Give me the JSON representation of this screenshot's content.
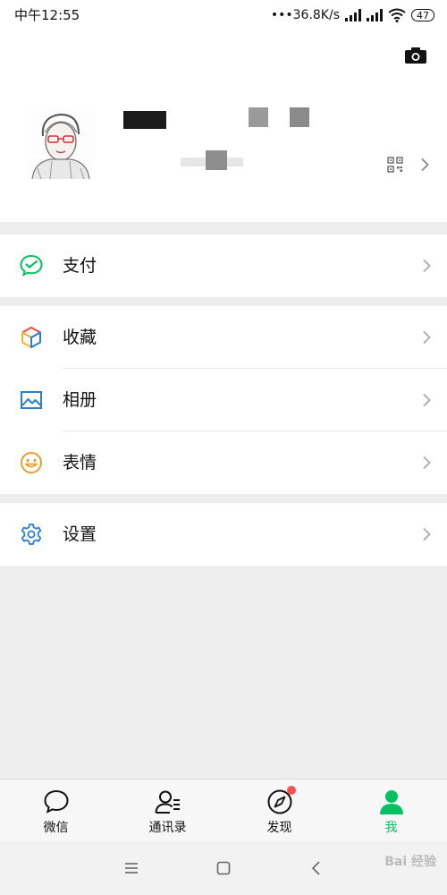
{
  "status_bar": {
    "time": "中午12:55",
    "speed": "•••36.8K/s",
    "battery": "47"
  },
  "profile": {
    "camera_icon": "camera-icon",
    "qr_icon": "qr-code-icon"
  },
  "menu": {
    "pay": {
      "label": "支付",
      "icon": "wechat-pay-icon",
      "color": "#07c160"
    },
    "favorites": {
      "label": "收藏",
      "icon": "favorites-cube-icon"
    },
    "album": {
      "label": "相册",
      "icon": "album-picture-icon",
      "color": "#2b7fce"
    },
    "stickers": {
      "label": "表情",
      "icon": "emoji-smile-icon",
      "color": "#e3a02b"
    },
    "settings": {
      "label": "设置",
      "icon": "gear-icon",
      "color": "#2b7fce"
    }
  },
  "tabbar": {
    "tabs": [
      {
        "label": "微信",
        "icon": "chat-bubble-icon"
      },
      {
        "label": "通讯录",
        "icon": "contacts-icon"
      },
      {
        "label": "发现",
        "icon": "compass-icon"
      },
      {
        "label": "我",
        "icon": "person-icon"
      }
    ],
    "active_color": "#07c160",
    "badge_color": "#fa5151"
  },
  "watermark": "Bai 经验"
}
